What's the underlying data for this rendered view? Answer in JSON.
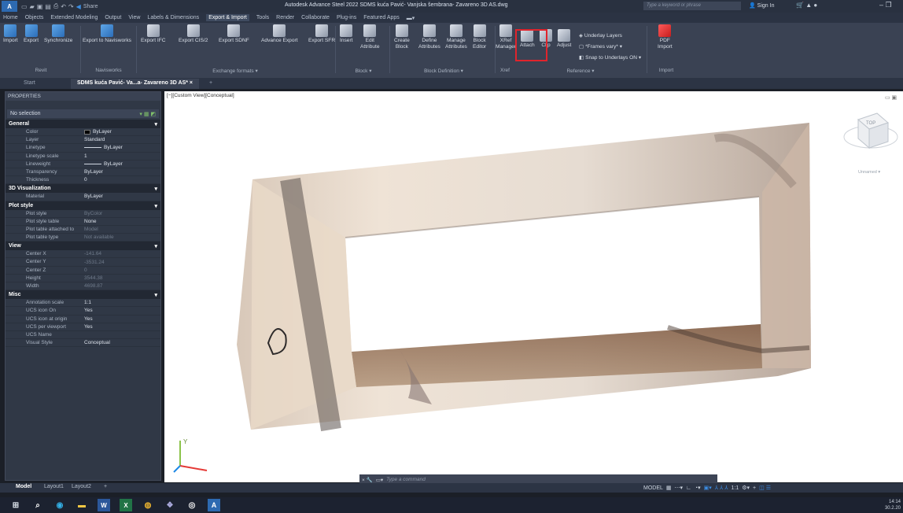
{
  "titlebar": {
    "logo": "A",
    "app_title": "Autodesk Advance Steel 2022   SDMS kuća Pavić- Vanjska šembrana- Zavareno 3D AS.dwg",
    "search_placeholder": "Type a keyword or phrase",
    "sign_in": "Sign In",
    "share": "Share"
  },
  "menu": {
    "tabs": [
      "Home",
      "Objects",
      "Extended Modeling",
      "Output",
      "View",
      "Labels & Dimensions",
      "Export & Import",
      "Tools",
      "Render",
      "Collaborate",
      "Plug-ins",
      "Featured Apps"
    ],
    "active": "Export & Import"
  },
  "ribbon": {
    "buttons": {
      "import": "Import",
      "export": "Export",
      "synchronize": "Synchronize",
      "export_navisworks": "Export to Navisworks",
      "export_ifc": "Export IFC",
      "export_cis2": "Export CIS/2",
      "export_sdnf": "Export SDNF",
      "advance_export": "Advance Export",
      "export_sfr": "Export SFR",
      "insert": "Insert",
      "edit_attribute_1": "Edit",
      "edit_attribute_2": "Attribute",
      "create_block_1": "Create",
      "create_block_2": "Block",
      "define_attributes_1": "Define",
      "define_attributes_2": "Attributes",
      "manage_attributes_1": "Manage",
      "manage_attributes_2": "Attributes",
      "block_editor_1": "Block",
      "block_editor_2": "Editor",
      "xref_manager_1": "XRef",
      "xref_manager_2": "Manager",
      "attach": "Attach",
      "clip": "Clip",
      "adjust": "Adjust",
      "underlay_layers": "Underlay Layers",
      "frames_vary": "*Frames vary*",
      "snap_to_underlays": "Snap to Underlays ON",
      "pdf_import_1": "PDF",
      "pdf_import_2": "Import"
    },
    "panels": {
      "revit": "Revit",
      "navisworks": "Navisworks",
      "exchange_formats": "Exchange formats ▾",
      "block": "Block ▾",
      "block_definition": "Block Definition ▾",
      "xref": "Xref",
      "reference": "Reference ▾",
      "import": "Import"
    }
  },
  "tabs": {
    "start": "Start",
    "active_doc": "SDMS kuća Pavić- Va...a- Zavareno 3D AS*",
    "close": "×",
    "add": "+"
  },
  "properties": {
    "title": "PROPERTIES",
    "selection": "No selection",
    "sections": [
      {
        "name": "General",
        "rows": [
          [
            "Color",
            "ByLayer"
          ],
          [
            "Layer",
            "Standard"
          ],
          [
            "Linetype",
            "ByLayer"
          ],
          [
            "Linetype scale",
            "1"
          ],
          [
            "Lineweight",
            "ByLayer"
          ],
          [
            "Transparency",
            "ByLayer"
          ],
          [
            "Thickness",
            "0"
          ]
        ]
      },
      {
        "name": "3D Visualization",
        "rows": [
          [
            "Material",
            "ByLayer"
          ]
        ]
      },
      {
        "name": "Plot style",
        "rows": [
          [
            "Plot style",
            "ByColor"
          ],
          [
            "Plot style table",
            "None"
          ],
          [
            "Plot table attached to",
            "Model"
          ],
          [
            "Plot table type",
            "Not available"
          ]
        ]
      },
      {
        "name": "View",
        "rows": [
          [
            "Center X",
            "-141.64"
          ],
          [
            "Center Y",
            "-3531.24"
          ],
          [
            "Center Z",
            "0"
          ],
          [
            "Height",
            "3544.38"
          ],
          [
            "Width",
            "4698.87"
          ]
        ]
      },
      {
        "name": "Misc",
        "rows": [
          [
            "Annotation scale",
            "1:1"
          ],
          [
            "UCS icon On",
            "Yes"
          ],
          [
            "UCS icon at origin",
            "Yes"
          ],
          [
            "UCS per viewport",
            "Yes"
          ],
          [
            "UCS Name",
            ""
          ],
          [
            "Visual Style",
            "Conceptual"
          ]
        ]
      }
    ]
  },
  "viewport": {
    "label": "[−][Custom View][Conceptual]",
    "viewcube_top": "TOP",
    "viewcube_unnamed": "Unnamed ▾",
    "ucs_y": "Y"
  },
  "command": {
    "placeholder": "Type a command"
  },
  "layouts": [
    "Model",
    "Layout1",
    "Layout2",
    "+"
  ],
  "status": {
    "model": "MODEL",
    "scale": "1:1"
  },
  "clock": {
    "time": "14:14",
    "date": "30.2.20"
  },
  "colors": {
    "ribbon_bg": "#3a4253",
    "highlight": "#e0242c",
    "viewport_bg": "#ffffff"
  }
}
